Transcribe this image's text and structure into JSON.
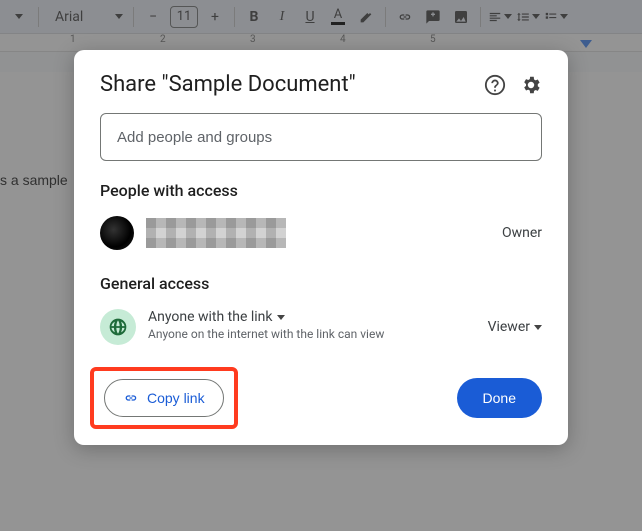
{
  "toolbar": {
    "font_name": "Arial",
    "font_size": "11",
    "ruler_marks": [
      "1",
      "2",
      "3",
      "4",
      "5"
    ]
  },
  "document": {
    "visible_text": "s a sample"
  },
  "dialog": {
    "title": "Share \"Sample Document\"",
    "add_placeholder": "Add people and groups",
    "people_heading": "People with access",
    "owner_role": "Owner",
    "general_heading": "General access",
    "general": {
      "scope": "Anyone with the link",
      "description": "Anyone on the internet with the link can view",
      "role": "Viewer"
    },
    "copy_label": "Copy link",
    "done_label": "Done"
  }
}
